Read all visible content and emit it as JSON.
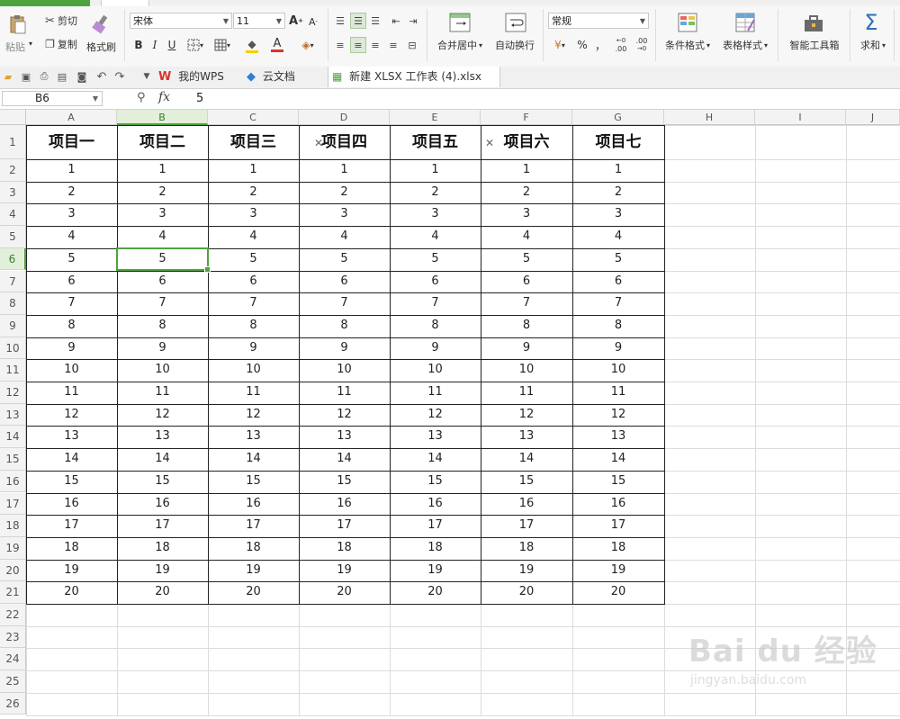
{
  "colors": {
    "accent": "#4ea33e",
    "wps_red": "#d8342c",
    "selection_fill": "#e2efda"
  },
  "ribbon": {
    "paste": "粘贴",
    "cut": "剪切",
    "copy": "复制",
    "format_painter": "格式刷",
    "font_name": "宋体",
    "font_size": "11",
    "number_format": "常规",
    "merge_center": "合并居中",
    "wrap_text": "自动换行",
    "cond_format": "条件格式",
    "table_style": "表格样式",
    "smart_toolbox": "智能工具箱",
    "sum": "求和",
    "bold": "B",
    "italic": "I",
    "underline": "U",
    "grow_font": "A",
    "shrink_font": "A",
    "percent": "%",
    "comma": "，",
    "inc_decimal": ".00",
    "dec_decimal": ".00"
  },
  "tabs": {
    "my_wps": "我的WPS",
    "cloud_docs": "云文档",
    "workbook": "新建 XLSX 工作表 (4).xlsx",
    "new_tab": "+"
  },
  "formula_bar": {
    "name_box": "B6",
    "fx": "fx",
    "value": "5"
  },
  "sheet": {
    "columns": [
      "A",
      "B",
      "C",
      "D",
      "E",
      "F",
      "G",
      "H",
      "I",
      "J"
    ],
    "row_numbers": [
      "1",
      "2",
      "3",
      "4",
      "5",
      "6",
      "7",
      "8",
      "9",
      "10",
      "11",
      "12",
      "13",
      "14",
      "15",
      "16",
      "17",
      "18",
      "19",
      "20",
      "21",
      "22",
      "23",
      "24",
      "25",
      "26"
    ],
    "header_row": [
      "项目一",
      "项目二",
      "项目三",
      "项目四",
      "项目五",
      "项目六",
      "项目七"
    ],
    "rows": [
      [
        "1",
        "1",
        "1",
        "1",
        "1",
        "1",
        "1"
      ],
      [
        "2",
        "2",
        "2",
        "2",
        "2",
        "2",
        "2"
      ],
      [
        "3",
        "3",
        "3",
        "3",
        "3",
        "3",
        "3"
      ],
      [
        "4",
        "4",
        "4",
        "4",
        "4",
        "4",
        "4"
      ],
      [
        "5",
        "5",
        "5",
        "5",
        "5",
        "5",
        "5"
      ],
      [
        "6",
        "6",
        "6",
        "6",
        "6",
        "6",
        "6"
      ],
      [
        "7",
        "7",
        "7",
        "7",
        "7",
        "7",
        "7"
      ],
      [
        "8",
        "8",
        "8",
        "8",
        "8",
        "8",
        "8"
      ],
      [
        "9",
        "9",
        "9",
        "9",
        "9",
        "9",
        "9"
      ],
      [
        "10",
        "10",
        "10",
        "10",
        "10",
        "10",
        "10"
      ],
      [
        "11",
        "11",
        "11",
        "11",
        "11",
        "11",
        "11"
      ],
      [
        "12",
        "12",
        "12",
        "12",
        "12",
        "12",
        "12"
      ],
      [
        "13",
        "13",
        "13",
        "13",
        "13",
        "13",
        "13"
      ],
      [
        "14",
        "14",
        "14",
        "14",
        "14",
        "14",
        "14"
      ],
      [
        "15",
        "15",
        "15",
        "15",
        "15",
        "15",
        "15"
      ],
      [
        "16",
        "16",
        "16",
        "16",
        "16",
        "16",
        "16"
      ],
      [
        "17",
        "17",
        "17",
        "17",
        "17",
        "17",
        "17"
      ],
      [
        "18",
        "18",
        "18",
        "18",
        "18",
        "18",
        "18"
      ],
      [
        "19",
        "19",
        "19",
        "19",
        "19",
        "19",
        "19"
      ],
      [
        "20",
        "20",
        "20",
        "20",
        "20",
        "20",
        "20"
      ]
    ],
    "selected_cell": {
      "column": "B",
      "row": "6"
    }
  },
  "watermark": {
    "logo": "Bai du 经验",
    "sub": "jingyan.baidu.com"
  }
}
